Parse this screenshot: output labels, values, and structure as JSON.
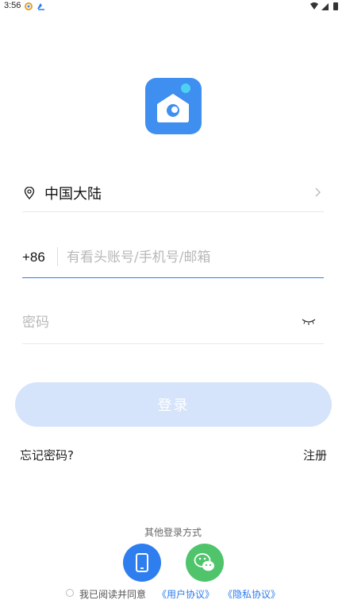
{
  "status_bar": {
    "time": "3:56"
  },
  "region": {
    "label": "中国大陆"
  },
  "phone": {
    "country_code": "+86",
    "placeholder": "有看头账号/手机号/邮箱",
    "value": ""
  },
  "password": {
    "placeholder": "密码",
    "value": ""
  },
  "login_button": {
    "label": "登录"
  },
  "links": {
    "forgot": "忘记密码?",
    "register": "注册"
  },
  "other_login": {
    "label": "其他登录方式",
    "methods": [
      "phone-icon",
      "wechat-icon"
    ]
  },
  "agreement": {
    "prefix": "我已阅读并同意",
    "user_agreement": "《用户协议》",
    "privacy_agreement": "《隐私协议》"
  },
  "colors": {
    "accent": "#2b7bf0",
    "logo": "#3f8ff0",
    "login_button_disabled": "#d5e4fa",
    "wechat": "#4fc46b"
  }
}
